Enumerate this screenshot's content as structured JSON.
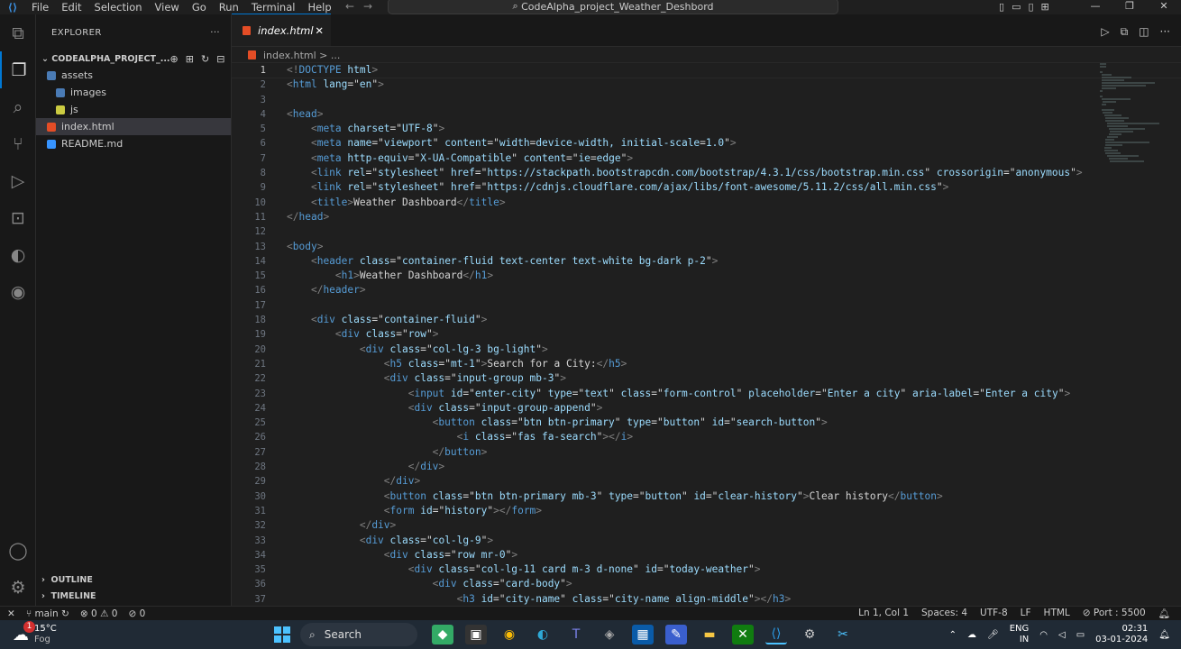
{
  "titlebar": {
    "menus": [
      "File",
      "Edit",
      "Selection",
      "View",
      "Go",
      "Run",
      "Terminal",
      "Help"
    ],
    "search": "CodeAlpha_project_Weather_Deshbord"
  },
  "sidebar": {
    "title": "EXPLORER",
    "project": "CODEALPHA_PROJECT_...",
    "items": [
      {
        "label": "assets",
        "type": "folder",
        "indent": 0
      },
      {
        "label": "images",
        "type": "folder",
        "indent": 1
      },
      {
        "label": "js",
        "type": "folder",
        "indent": 1
      },
      {
        "label": "index.html",
        "type": "html",
        "indent": 0
      },
      {
        "label": "README.md",
        "type": "md",
        "indent": 0
      }
    ],
    "outline": "OUTLINE",
    "timeline": "TIMELINE"
  },
  "editor": {
    "tab": "index.html",
    "breadcrumb_file": "index.html",
    "breadcrumb_more": "...",
    "lines": [
      "<!DOCTYPE html>",
      "<html lang=\"en\">",
      "",
      "<head>",
      "    <meta charset=\"UTF-8\">",
      "    <meta name=\"viewport\" content=\"width=device-width, initial-scale=1.0\">",
      "    <meta http-equiv=\"X-UA-Compatible\" content=\"ie=edge\">",
      "    <link rel=\"stylesheet\" href=\"https://stackpath.bootstrapcdn.com/bootstrap/4.3.1/css/bootstrap.min.css\" crossorigin=\"anonymous\">",
      "    <link rel=\"stylesheet\" href=\"https://cdnjs.cloudflare.com/ajax/libs/font-awesome/5.11.2/css/all.min.css\">",
      "    <title>Weather Dashboard</title>",
      "</head>",
      "",
      "<body>",
      "    <header class=\"container-fluid text-center text-white bg-dark p-2\">",
      "        <h1>Weather Dashboard</h1>",
      "    </header>",
      "",
      "    <div class=\"container-fluid\">",
      "        <div class=\"row\">",
      "            <div class=\"col-lg-3 bg-light\">",
      "                <h5 class=\"mt-1\">Search for a City:</h5>",
      "                <div class=\"input-group mb-3\">",
      "                    <input id=\"enter-city\" type=\"text\" class=\"form-control\" placeholder=\"Enter a city\" aria-label=\"Enter a city\">",
      "                    <div class=\"input-group-append\">",
      "                        <button class=\"btn btn-primary\" type=\"button\" id=\"search-button\">",
      "                            <i class=\"fas fa-search\"></i>",
      "                        </button>",
      "                    </div>",
      "                </div>",
      "                <button class=\"btn btn-primary mb-3\" type=\"button\" id=\"clear-history\">Clear history</button>",
      "                <form id=\"history\"></form>",
      "            </div>",
      "            <div class=\"col-lg-9\">",
      "                <div class=\"row mr-0\">",
      "                    <div class=\"col-lg-11 card m-3 d-none\" id=\"today-weather\">",
      "                        <div class=\"card-body\">",
      "                            <h3 id=\"city-name\" class=\"city-name align-middle\"></h3>"
    ]
  },
  "statusbar": {
    "branch": "main",
    "problems": "⊗ 0 ⚠ 0",
    "ports": "0",
    "position": "Ln 1, Col 1",
    "spaces": "Spaces: 4",
    "encoding": "UTF-8",
    "eol": "LF",
    "language": "HTML",
    "port": "Port : 5500"
  },
  "taskbar": {
    "temp": "15°C",
    "condition": "Fog",
    "search": "Search",
    "lang1": "ENG",
    "lang2": "IN",
    "time": "02:31",
    "date": "03-01-2024",
    "badge": "1"
  }
}
